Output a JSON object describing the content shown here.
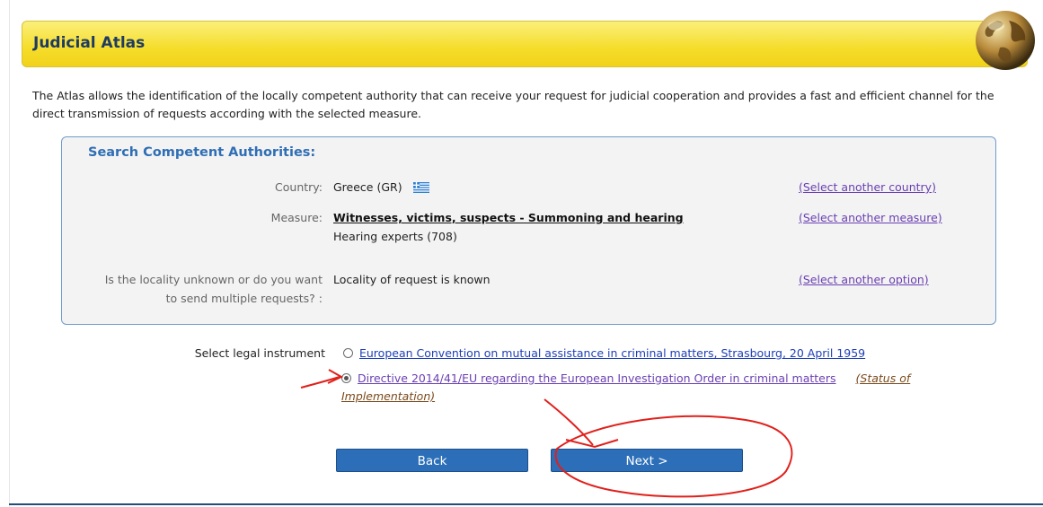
{
  "header": {
    "title": "Judicial Atlas"
  },
  "intro": "The Atlas allows the identification of the locally competent authority that can receive your request for judicial cooperation and provides a fast and efficient channel for the direct transmission of requests according with the selected measure.",
  "search": {
    "heading": "Search Competent Authorities:",
    "country": {
      "label": "Country:",
      "value": "Greece (GR)",
      "link": "(Select another country)"
    },
    "measure": {
      "label": "Measure:",
      "value": "Witnesses, victims, suspects - Summoning and hearing",
      "subvalue": "Hearing experts (708)",
      "link": "(Select another measure)"
    },
    "locality": {
      "label_line1": "Is the locality unknown or do you want",
      "label_line2": "to send multiple requests? :",
      "value": "Locality of request is known",
      "link": "(Select another option)"
    }
  },
  "legal": {
    "label": "Select legal instrument",
    "options": [
      {
        "text": "European Convention on mutual assistance in criminal matters, Strasbourg, 20 April 1959",
        "selected": false
      },
      {
        "text": "Directive 2014/41/EU regarding the European Investigation Order in criminal matters",
        "selected": true,
        "status_link_part1": "(Status of",
        "status_link_part2": "Implementation)"
      }
    ]
  },
  "buttons": {
    "back": "Back",
    "next": "Next >"
  },
  "colors": {
    "header_yellow": "#f5dd2a",
    "title_blue": "#1f3b63",
    "button_blue": "#2c6fb8",
    "link_purple": "#6a3fb2",
    "annotation_red": "#e0201b"
  }
}
